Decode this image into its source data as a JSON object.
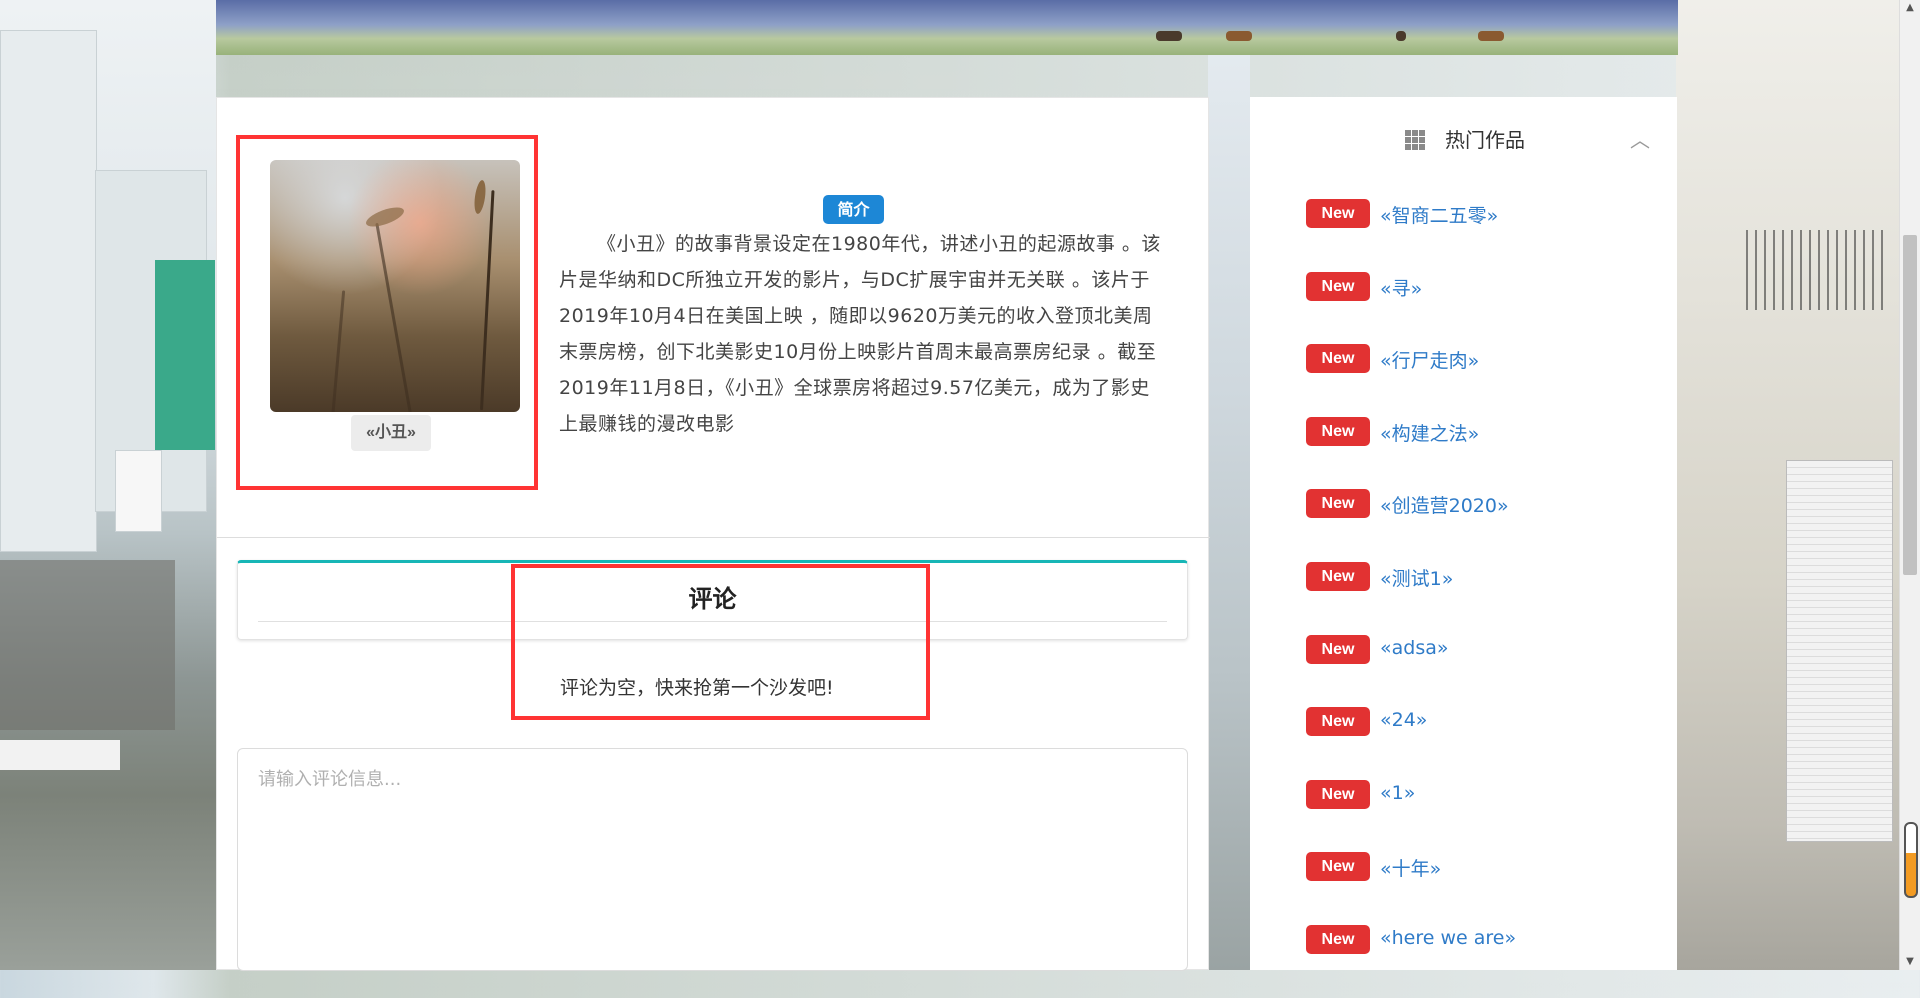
{
  "movie": {
    "poster_caption": "«小丑»",
    "intro_badge": "简介",
    "intro_text": "《小丑》的故事背景设定在1980年代，讲述小丑的起源故事 。该片是华纳和DC所独立开发的影片，与DC扩展宇宙并无关联 。该片于2019年10月4日在美国上映 ，随即以9620万美元的收入登顶北美周末票房榜，创下北美影史10月份上映影片首周末最高票房纪录 。截至2019年11月8日，《小丑》全球票房将超过9.57亿美元，成为了影史上最赚钱的漫改电影"
  },
  "comments": {
    "title": "评论",
    "empty_message": "评论为空，快来抢第一个沙发吧!",
    "input_placeholder": "请输入评论信息..."
  },
  "sidebar": {
    "title": "热门作品",
    "items": [
      {
        "badge": "New",
        "title": "«智商二五零»"
      },
      {
        "badge": "New",
        "title": "«寻»"
      },
      {
        "badge": "New",
        "title": "«行尸走肉»"
      },
      {
        "badge": "New",
        "title": "«构建之法»"
      },
      {
        "badge": "New",
        "title": "«创造营2020»"
      },
      {
        "badge": "New",
        "title": "«测试1»"
      },
      {
        "badge": "New",
        "title": "«adsa»"
      },
      {
        "badge": "New",
        "title": "«24»"
      },
      {
        "badge": "New",
        "title": "«1»"
      },
      {
        "badge": "New",
        "title": "«十年»"
      },
      {
        "badge": "New",
        "title": "«here we are»"
      }
    ]
  },
  "colors": {
    "highlight_border": "#ff3333",
    "intro_badge_bg": "#1d87d6",
    "new_badge_bg": "#e23232",
    "link": "#2f7bc8",
    "comment_accent": "#17b6b6"
  }
}
